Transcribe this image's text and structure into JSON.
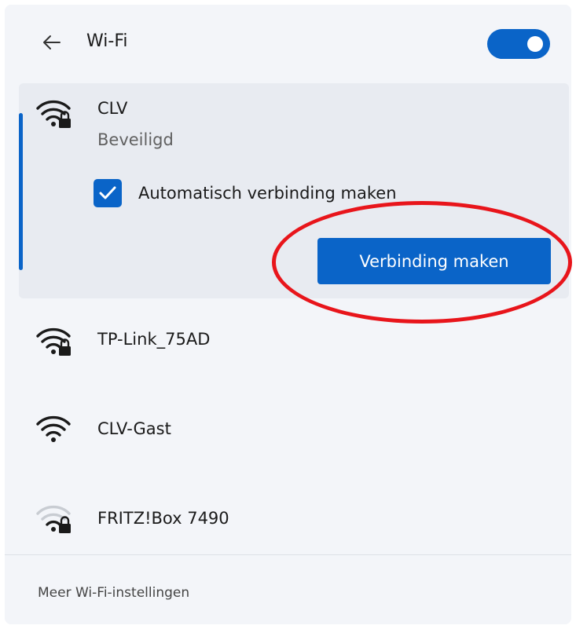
{
  "header": {
    "title": "Wi-Fi",
    "back_icon": "arrow-left-icon",
    "toggle_state": "on"
  },
  "colors": {
    "accent": "#0a64c8",
    "annotation": "#e8151b",
    "panel_bg": "#f3f5f9",
    "selected_bg": "#e8ebf1"
  },
  "selected_network": {
    "name": "CLV",
    "status": "Beveiligd",
    "icon": "wifi-secured-icon",
    "auto_connect_label": "Automatisch verbinding maken",
    "auto_connect_checked": true,
    "connect_label": "Verbinding maken"
  },
  "networks": [
    {
      "name": "TP-Link_75AD",
      "icon": "wifi-secured-icon",
      "secured": true,
      "signal": "full"
    },
    {
      "name": "CLV-Gast",
      "icon": "wifi-icon",
      "secured": false,
      "signal": "full"
    },
    {
      "name": "FRITZ!Box 7490",
      "icon": "wifi-secured-icon",
      "secured": true,
      "signal": "weak"
    }
  ],
  "footer": {
    "link": "Meer Wi-Fi-instellingen"
  }
}
